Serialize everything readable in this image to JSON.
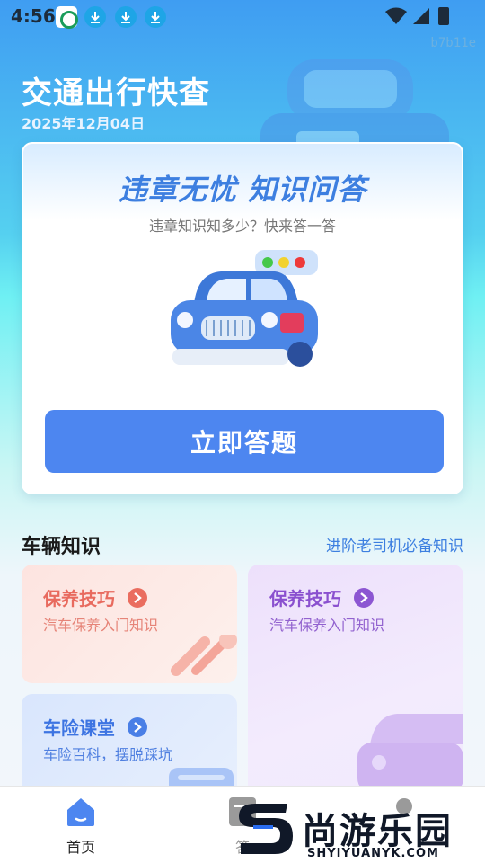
{
  "status_bar": {
    "time": "4:56",
    "icons": [
      "app-notification-icon",
      "download-icon",
      "download-icon",
      "download-icon",
      "wifi-icon",
      "cell-signal-icon",
      "battery-charging-icon"
    ]
  },
  "build_id": "b7b11e",
  "header": {
    "title": "交通出行快查",
    "date": "2025年12月04日"
  },
  "hero": {
    "title": "违章无忧 知识问答",
    "subtitle": "违章知识知多少？快来答一答",
    "button_label": "立即答题"
  },
  "section": {
    "title": "车辆知识",
    "link": "进阶老司机必备知识"
  },
  "cards": [
    {
      "title": "保养技巧",
      "subtitle": "汽车保养入门知识",
      "icon": "wrench-icon"
    },
    {
      "title": "保养技巧",
      "subtitle": "汽车保养入门知识",
      "icon": "car-icon"
    },
    {
      "title": "车险课堂",
      "subtitle": "车险百科，摆脱踩坑",
      "icon": "card-icon"
    }
  ],
  "bottom_nav": {
    "items": [
      {
        "label": "首页",
        "icon": "home-icon",
        "active": true
      },
      {
        "label": "答",
        "icon": "quiz-icon",
        "active": false
      },
      {
        "label": "",
        "icon": "profile-icon",
        "active": false
      }
    ]
  },
  "watermark": {
    "text": "尚游乐园",
    "url": "SHYIYUANYK.COM"
  },
  "colors": {
    "accent": "#4d86f0",
    "card_red": "#e86a5e",
    "card_purple": "#8a50cf",
    "card_blue": "#3d74e2"
  }
}
